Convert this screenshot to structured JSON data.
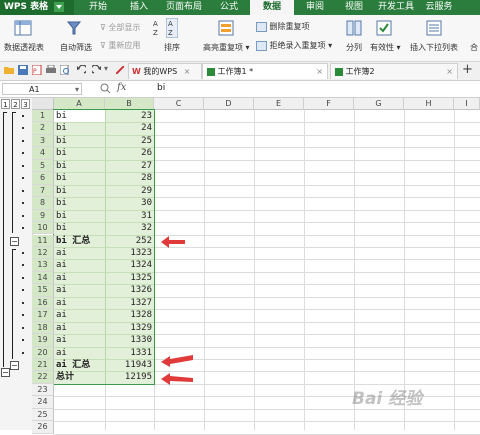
{
  "app": {
    "logo_label": "WPS 表格"
  },
  "menu": {
    "tabs": [
      "开始",
      "插入",
      "页面布局",
      "公式",
      "数据",
      "审阅",
      "视图",
      "开发工具",
      "云服务"
    ],
    "active": "数据"
  },
  "ribbon": {
    "pivot": "数据透视表",
    "autofilter": "自动筛选",
    "show_all": "全部显示",
    "reapply": "重新应用",
    "sort": "排序",
    "highlight_dup": "高亮重复项",
    "remove_dup": "删除重复项",
    "reject_dup": "拒绝录入重复项",
    "split": "分列",
    "validity": "有效性",
    "insert_dropdown": "插入下拉列表",
    "combine": "合"
  },
  "doc_tabs": [
    {
      "label": "我的WPS"
    },
    {
      "label": "工作簿1 *"
    },
    {
      "label": "工作簿2"
    }
  ],
  "formula_bar": {
    "name_box": "A1",
    "fx": "fx",
    "value": "bi"
  },
  "outline_levels": [
    "1",
    "2",
    "3"
  ],
  "columns": [
    "A",
    "B",
    "C",
    "D",
    "E",
    "F",
    "G",
    "H",
    "I"
  ],
  "rows": [
    {
      "n": "1",
      "a": "bi",
      "b": "23"
    },
    {
      "n": "2",
      "a": "bi",
      "b": "24"
    },
    {
      "n": "3",
      "a": "bi",
      "b": "25"
    },
    {
      "n": "4",
      "a": "bi",
      "b": "26"
    },
    {
      "n": "5",
      "a": "bi",
      "b": "27"
    },
    {
      "n": "6",
      "a": "bi",
      "b": "28"
    },
    {
      "n": "7",
      "a": "bi",
      "b": "29"
    },
    {
      "n": "8",
      "a": "bi",
      "b": "30"
    },
    {
      "n": "9",
      "a": "bi",
      "b": "31"
    },
    {
      "n": "10",
      "a": "bi",
      "b": "32"
    },
    {
      "n": "11",
      "a": "bi 汇总",
      "b": "252",
      "total": true
    },
    {
      "n": "12",
      "a": "ai",
      "b": "1323"
    },
    {
      "n": "13",
      "a": "ai",
      "b": "1324"
    },
    {
      "n": "14",
      "a": "ai",
      "b": "1325"
    },
    {
      "n": "15",
      "a": "ai",
      "b": "1326"
    },
    {
      "n": "16",
      "a": "ai",
      "b": "1327"
    },
    {
      "n": "17",
      "a": "ai",
      "b": "1328"
    },
    {
      "n": "18",
      "a": "ai",
      "b": "1329"
    },
    {
      "n": "19",
      "a": "ai",
      "b": "1330"
    },
    {
      "n": "20",
      "a": "ai",
      "b": "1331"
    },
    {
      "n": "21",
      "a": "ai 汇总",
      "b": "11943",
      "total": true
    },
    {
      "n": "22",
      "a": "总计",
      "b": "12195",
      "total": true
    },
    {
      "n": "23",
      "a": "",
      "b": ""
    },
    {
      "n": "24",
      "a": "",
      "b": ""
    },
    {
      "n": "25",
      "a": "",
      "b": ""
    },
    {
      "n": "26",
      "a": "",
      "b": ""
    }
  ],
  "watermark": "Bai 经验",
  "colors": {
    "menubar": "#2a7d3c",
    "selection": "#e2f0d9",
    "selection_border": "#3a9a4b",
    "arrow": "#e03a3a"
  }
}
